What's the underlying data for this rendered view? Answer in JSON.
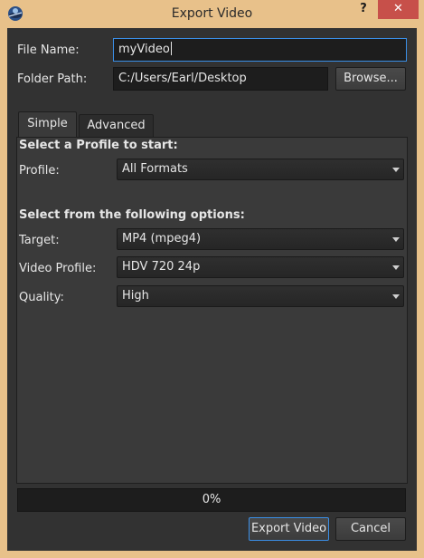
{
  "window": {
    "title": "Export Video",
    "help_glyph": "?",
    "close_glyph": "✕"
  },
  "file": {
    "label": "File Name:",
    "value": "myVideo"
  },
  "folder": {
    "label": "Folder Path:",
    "value": "C:/Users/Earl/Desktop",
    "browse_label": "Browse..."
  },
  "tabs": [
    {
      "label": "Simple",
      "active": true
    },
    {
      "label": "Advanced",
      "active": false
    }
  ],
  "simple": {
    "profile_section_title": "Select a Profile to start:",
    "profile_label": "Profile:",
    "profile_value": "All Formats",
    "options_section_title": "Select from the following options:",
    "target_label": "Target:",
    "target_value": "MP4 (mpeg4)",
    "video_profile_label": "Video Profile:",
    "video_profile_value": "HDV 720 24p",
    "quality_label": "Quality:",
    "quality_value": "High"
  },
  "progress": {
    "percent": 0,
    "text": "0%"
  },
  "footer": {
    "export_label": "Export Video",
    "cancel_label": "Cancel"
  },
  "colors": {
    "accent": "#3a8ee6",
    "close": "#c7504a",
    "frame": "#e8c18a",
    "background": "#323232"
  }
}
